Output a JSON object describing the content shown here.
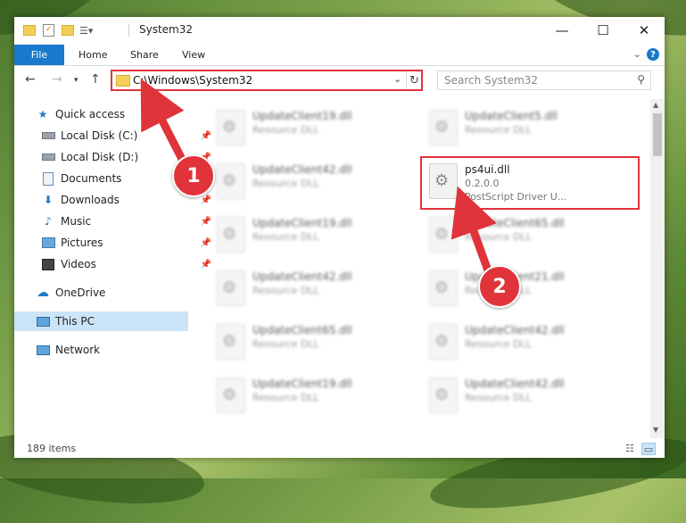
{
  "window": {
    "title": "System32",
    "controls": {
      "minimize": "—",
      "maximize": "☐",
      "close": "✕"
    }
  },
  "ribbon": {
    "tabs": [
      "File",
      "Home",
      "Share",
      "View"
    ],
    "help": "?"
  },
  "navbar": {
    "address": "C:\\Windows\\System32",
    "search_placeholder": "Search System32"
  },
  "sidebar": {
    "items": [
      {
        "label": "Quick access",
        "icon": "star-icon",
        "pinned": false
      },
      {
        "label": "Local Disk (C:)",
        "icon": "drive-icon",
        "pinned": true
      },
      {
        "label": "Local Disk (D:)",
        "icon": "drive-icon",
        "pinned": true
      },
      {
        "label": "Documents",
        "icon": "documents-icon",
        "pinned": true
      },
      {
        "label": "Downloads",
        "icon": "downloads-icon",
        "pinned": true
      },
      {
        "label": "Music",
        "icon": "music-icon",
        "pinned": true
      },
      {
        "label": "Pictures",
        "icon": "pictures-icon",
        "pinned": true
      },
      {
        "label": "Videos",
        "icon": "videos-icon",
        "pinned": true
      },
      {
        "label": "OneDrive",
        "icon": "onedrive-icon",
        "pinned": false
      },
      {
        "label": "This PC",
        "icon": "pc-icon",
        "pinned": false,
        "selected": true
      },
      {
        "label": "Network",
        "icon": "network-icon",
        "pinned": false
      }
    ]
  },
  "files": {
    "left_column": [
      {
        "name": "UpdateClient19.dll",
        "type": "Resource DLL"
      },
      {
        "name": "UpdateClient42.dll",
        "type": "Resource DLL"
      },
      {
        "name": "UpdateClient19.dll",
        "type": "Resource DLL"
      },
      {
        "name": "UpdateClient42.dll",
        "type": "Resource DLL"
      },
      {
        "name": "UpdateClient65.dll",
        "type": "Resource DLL"
      },
      {
        "name": "UpdateClient19.dll",
        "type": "Resource DLL"
      }
    ],
    "right_column": [
      {
        "name": "UpdateClient5.dll",
        "type": "Resource DLL"
      },
      {
        "name": "ps4ui.dll",
        "version": "0.2.0.0",
        "description": "PostScript Driver U...",
        "highlighted": true
      },
      {
        "name": "UpdateClient65.dll",
        "type": "Resource DLL"
      },
      {
        "name": "UpdateClient21.dll",
        "type": "Resource DLL"
      },
      {
        "name": "UpdateClient42.dll",
        "type": "Resource DLL"
      },
      {
        "name": "UpdateClient42.dll",
        "type": "Resource DLL"
      }
    ]
  },
  "status": {
    "item_count": "189 items"
  },
  "annotations": {
    "step1": "1",
    "step2": "2",
    "accent": "#e0333a"
  },
  "colors": {
    "file_tab": "#1979ca",
    "selection": "#cce4f7"
  }
}
